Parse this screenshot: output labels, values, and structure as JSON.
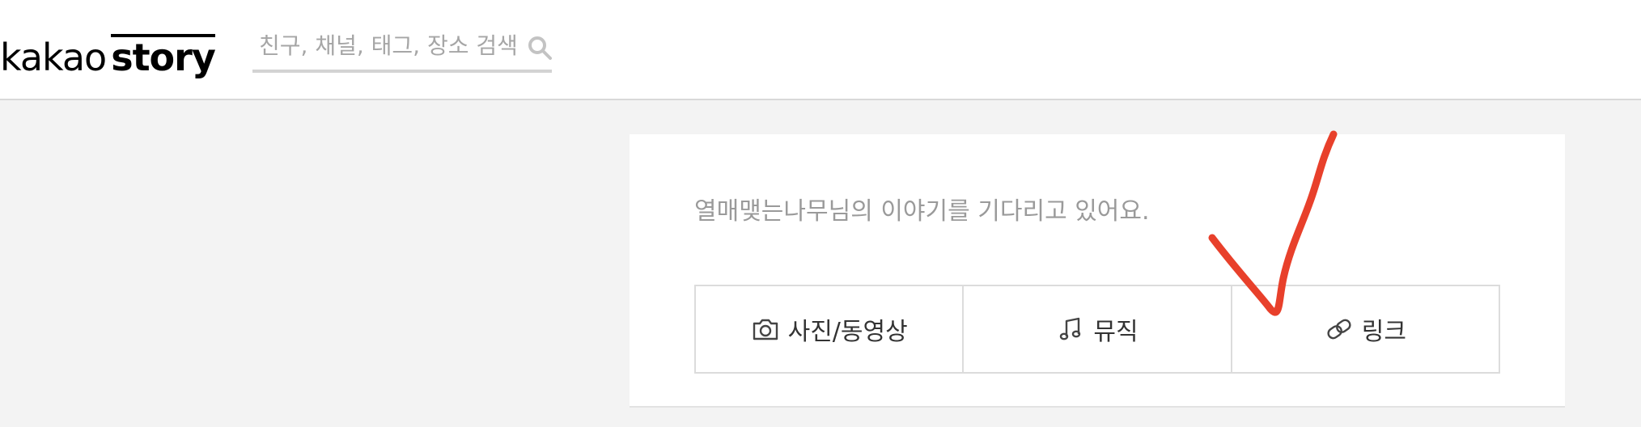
{
  "header": {
    "logo": {
      "part1": "kakao",
      "part2": "story"
    },
    "search": {
      "placeholder": "친구, 채널, 태그, 장소 검색",
      "icon": "search-icon"
    }
  },
  "composer": {
    "prompt": "열매맺는나무님의 이야기를 기다리고 있어요.",
    "actions": [
      {
        "label": "사진/동영상",
        "icon": "camera-icon"
      },
      {
        "label": "뮤직",
        "icon": "music-note-icon"
      },
      {
        "label": "링크",
        "icon": "link-icon"
      }
    ]
  },
  "annotation": {
    "type": "checkmark",
    "color": "#e8402b"
  },
  "colors": {
    "page_background": "#f3f3f3",
    "header_background": "#ffffff",
    "divider": "#d8d8d8",
    "prompt_text": "#9a9a9a",
    "action_text": "#333333",
    "annotation": "#e8402b"
  }
}
